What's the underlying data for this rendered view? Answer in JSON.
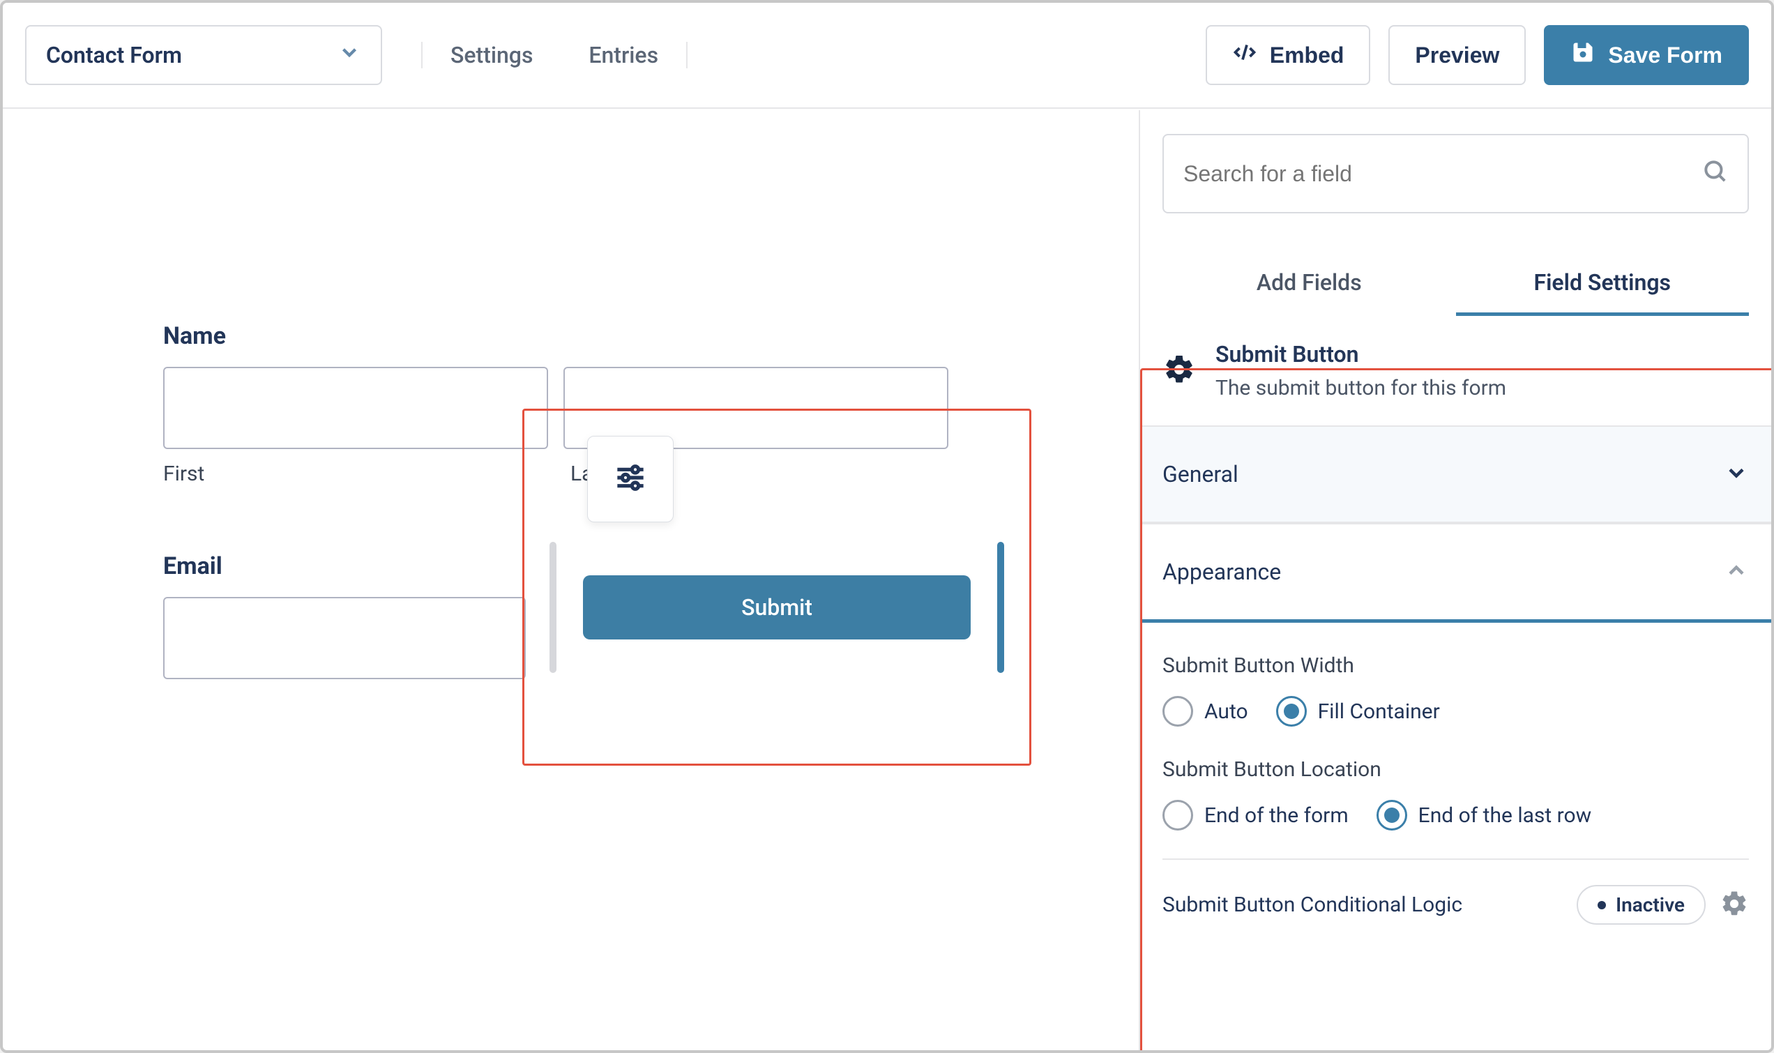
{
  "header": {
    "form_name": "Contact Form",
    "tabs": {
      "settings": "Settings",
      "entries": "Entries"
    },
    "buttons": {
      "embed": "Embed",
      "preview": "Preview",
      "save": "Save Form"
    }
  },
  "canvas": {
    "name_field": {
      "label": "Name",
      "first_sub": "First",
      "last_sub": "Last"
    },
    "email_field": {
      "label": "Email"
    },
    "submit_label": "Submit"
  },
  "sidebar": {
    "search_placeholder": "Search for a field",
    "tabs": {
      "add": "Add Fields",
      "settings": "Field Settings"
    },
    "field_info": {
      "title": "Submit Button",
      "desc": "The submit button for this form"
    },
    "sections": {
      "general": "General",
      "appearance": "Appearance"
    },
    "appearance": {
      "width_label": "Submit Button Width",
      "width_options": {
        "auto": "Auto",
        "fill": "Fill Container"
      },
      "location_label": "Submit Button Location",
      "location_options": {
        "end_form": "End of the form",
        "end_row": "End of the last row"
      }
    },
    "logic": {
      "title": "Submit Button Conditional Logic",
      "status": "Inactive"
    }
  }
}
